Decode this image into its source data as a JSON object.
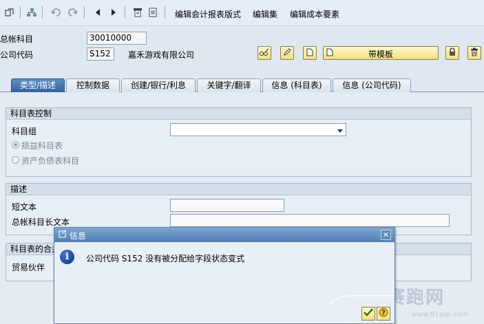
{
  "toolbar": {
    "links": [
      "编辑会计报表版式",
      "编辑集",
      "编辑成本要素"
    ],
    "icons": [
      "switch-icon",
      "hierarchy-icon",
      "undo-icon",
      "redo-icon",
      "previous-icon",
      "next-icon",
      "print-icon",
      "document-icon"
    ]
  },
  "header": {
    "gl_account_label": "总帐科目",
    "gl_account_value": "30010000",
    "company_code_label": "公司代码",
    "company_code_value": "S152",
    "company_name": "嘉禾游戏有限公司",
    "template_button_label": "带模板"
  },
  "tabs": [
    {
      "label": "类型/描述",
      "active": true
    },
    {
      "label": "控制数据",
      "active": false
    },
    {
      "label": "创建/银行/利息",
      "active": false
    },
    {
      "label": "关键字/翻译",
      "active": false
    },
    {
      "label": "信息 (科目表)",
      "active": false
    },
    {
      "label": "信息 (公司代码)",
      "active": false
    }
  ],
  "coa_control": {
    "title": "科目表控制",
    "account_group_label": "科目组",
    "account_group_value": "",
    "radio_pl": "损益科目表",
    "radio_bs": "资产负债表科目",
    "selected": "pl"
  },
  "description": {
    "title": "描述",
    "short_text_label": "短文本",
    "short_text_value": "",
    "long_text_label": "总帐科目长文本",
    "long_text_value": ""
  },
  "consolidation": {
    "title_visible": "科目表的合并",
    "trading_partner_label": "贸易伙伴"
  },
  "dialog": {
    "title": "信息",
    "message": "公司代码 S152 没有被分配给字段状态变式"
  },
  "watermark": {
    "text": "赛跑网",
    "url": "www.91sap.com"
  },
  "colors": {
    "active_tab": "#2e63a3",
    "button_yellow": "#f2df7c",
    "dialog_title": "#4f7fb5",
    "background": "#dfe8f1"
  }
}
